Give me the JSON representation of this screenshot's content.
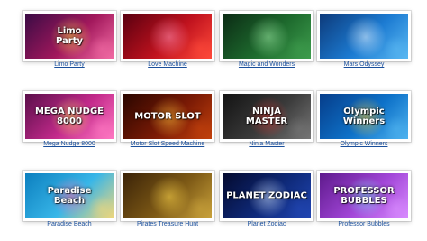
{
  "games": [
    {
      "label": "Limo Party",
      "art_title": "Limo\nParty",
      "colors": [
        "#3a0b45",
        "#a2185c",
        "#f26ba4"
      ],
      "accent": "#ffd34e",
      "icon": "limousine-logo-icon"
    },
    {
      "label": "Love Machine",
      "art_title": "",
      "colors": [
        "#5a0010",
        "#c0121e",
        "#ff4a3a"
      ],
      "accent": "#ff8fb1",
      "icon": "heart-icon"
    },
    {
      "label": "Magic and Wonders",
      "art_title": "",
      "colors": [
        "#0b2a14",
        "#1e6b2e",
        "#3e9d4d"
      ],
      "accent": "#9be7a2",
      "icon": "forest-icon"
    },
    {
      "label": "Mars Odyssey",
      "art_title": "",
      "colors": [
        "#0d3a7a",
        "#1c7bd2",
        "#5ab8f2"
      ],
      "accent": "#e6f4ff",
      "icon": "planet-icon"
    },
    {
      "label": "Mega Nudge 8000",
      "art_title": "MEGA NUDGE\n8000",
      "colors": [
        "#5a0e4a",
        "#c32a8b",
        "#ff78c2"
      ],
      "accent": "#ffe35c",
      "icon": "fruit-icon"
    },
    {
      "label": "Motor Slot Speed Machine",
      "art_title": "MOTOR SLOT",
      "colors": [
        "#2a0600",
        "#7a1a05",
        "#c2410c"
      ],
      "accent": "#ffc23a",
      "icon": "racing-car-icon"
    },
    {
      "label": "Ninja Master",
      "art_title": "NINJA\nMASTER",
      "colors": [
        "#131313",
        "#3b3b3b",
        "#767676"
      ],
      "accent": "#e53935",
      "icon": "ninja-icon"
    },
    {
      "label": "Olympic Winners",
      "art_title": "Olympic\nWinners",
      "colors": [
        "#063d8a",
        "#0e72c9",
        "#4fb3ef"
      ],
      "accent": "#ffcf33",
      "icon": "torch-icon"
    },
    {
      "label": "Paradise Beach",
      "art_title": "Paradise\nBeach",
      "colors": [
        "#0c7fbf",
        "#38b6e8",
        "#f1d77a"
      ],
      "accent": "#ff6fb1",
      "icon": "palm-tree-icon"
    },
    {
      "label": "Pirates Treasure Hunt",
      "art_title": "",
      "colors": [
        "#3b2308",
        "#7e5a16",
        "#c9a23b"
      ],
      "accent": "#ffd84d",
      "icon": "pirate-icon"
    },
    {
      "label": "Planet Zodiac",
      "art_title": "PLANET ZODIAC",
      "colors": [
        "#040a2e",
        "#0f2a7a",
        "#2146b3"
      ],
      "accent": "#cfe2ff",
      "icon": "zodiac-icon"
    },
    {
      "label": "Professor Bubbles",
      "art_title": "PROFESSOR\nBUBBLES",
      "colors": [
        "#5e1a8c",
        "#a246d8",
        "#d98cff"
      ],
      "accent": "#7fe6ff",
      "icon": "bubble-icon"
    }
  ]
}
